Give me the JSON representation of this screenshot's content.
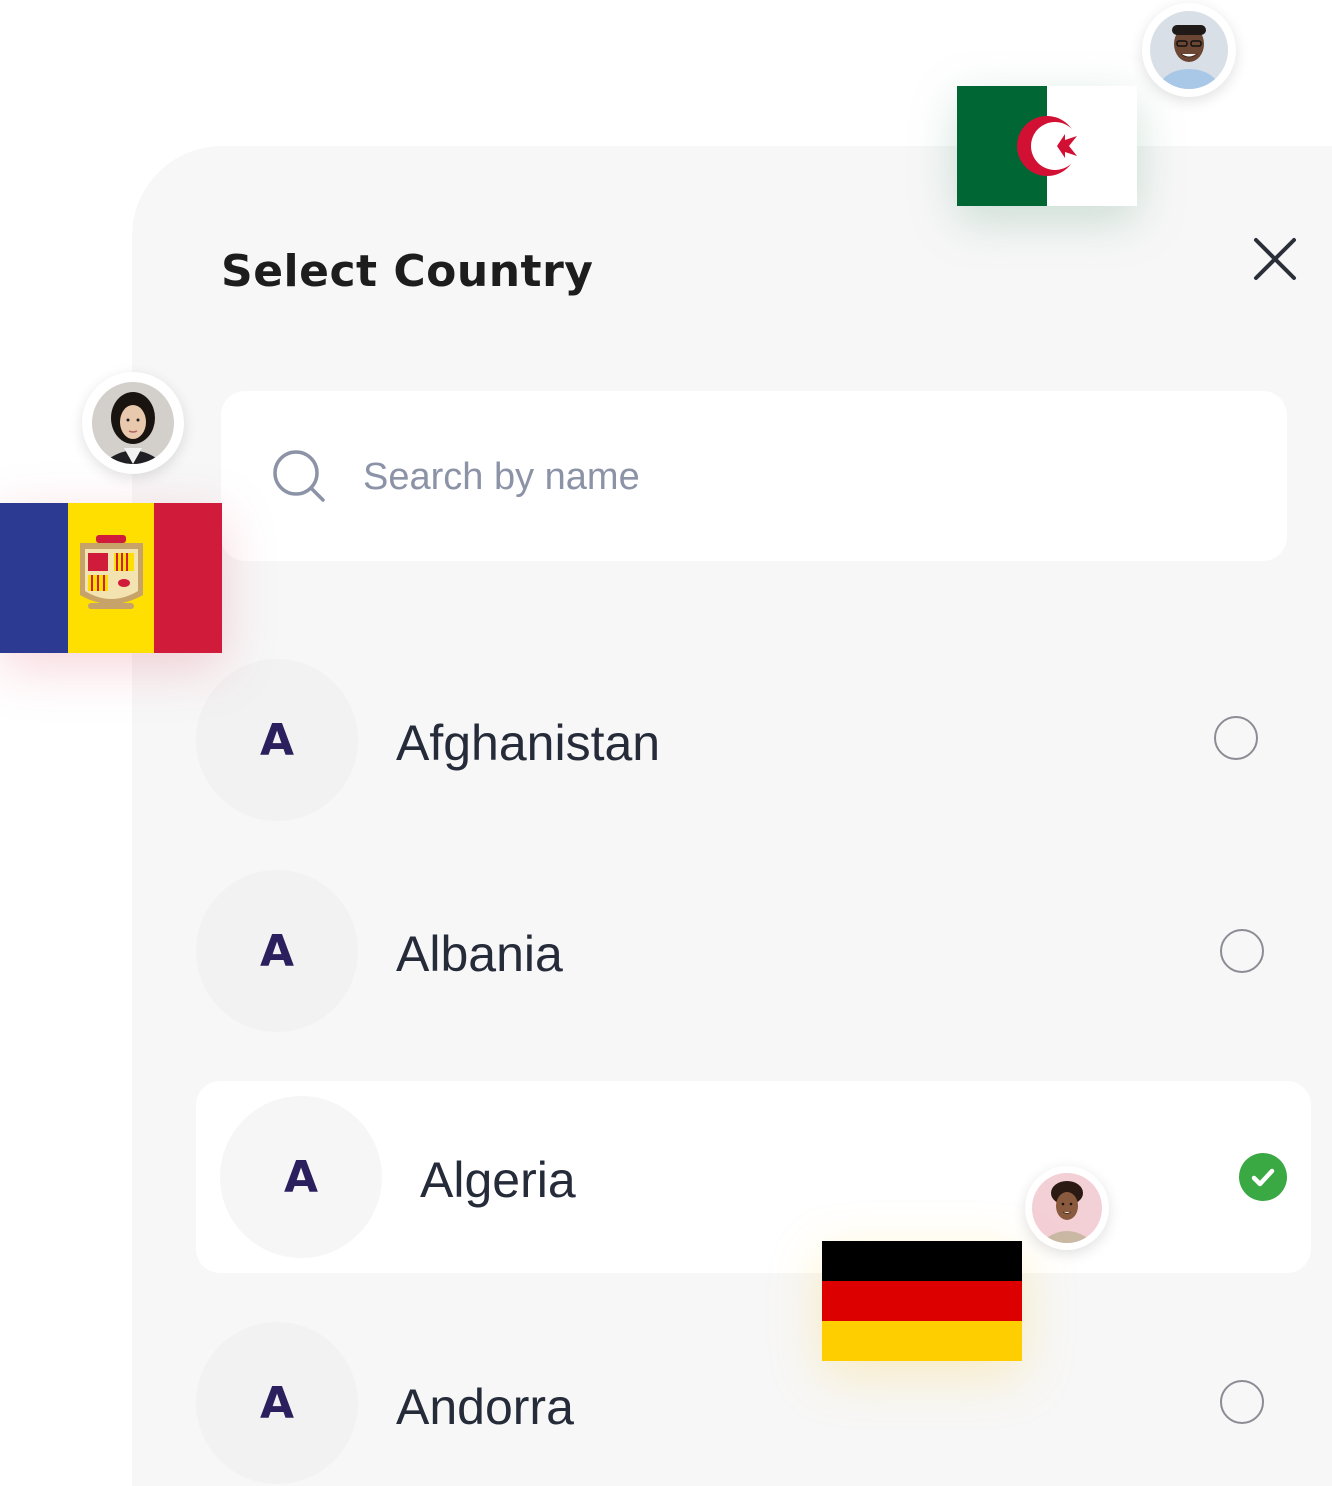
{
  "dialog": {
    "title": "Select Country",
    "close_icon": "close-icon"
  },
  "search": {
    "icon": "search-icon",
    "placeholder": "Search by name",
    "value": ""
  },
  "countries": [
    {
      "letter": "A",
      "name": "Afghanistan",
      "selected": false
    },
    {
      "letter": "A",
      "name": "Albania",
      "selected": false
    },
    {
      "letter": "A",
      "name": "Algeria",
      "selected": true
    },
    {
      "letter": "A",
      "name": "Andorra",
      "selected": false
    }
  ],
  "decorations": {
    "flags": [
      "Algeria flag",
      "Andorra flag",
      "Germany flag"
    ],
    "avatars": [
      "man avatar",
      "woman avatar",
      "woman avatar"
    ]
  },
  "colors": {
    "panel_bg": "#f7f7f7",
    "letter": "#2b1f5e",
    "check": "#3aa843",
    "placeholder": "#8c93a7"
  }
}
